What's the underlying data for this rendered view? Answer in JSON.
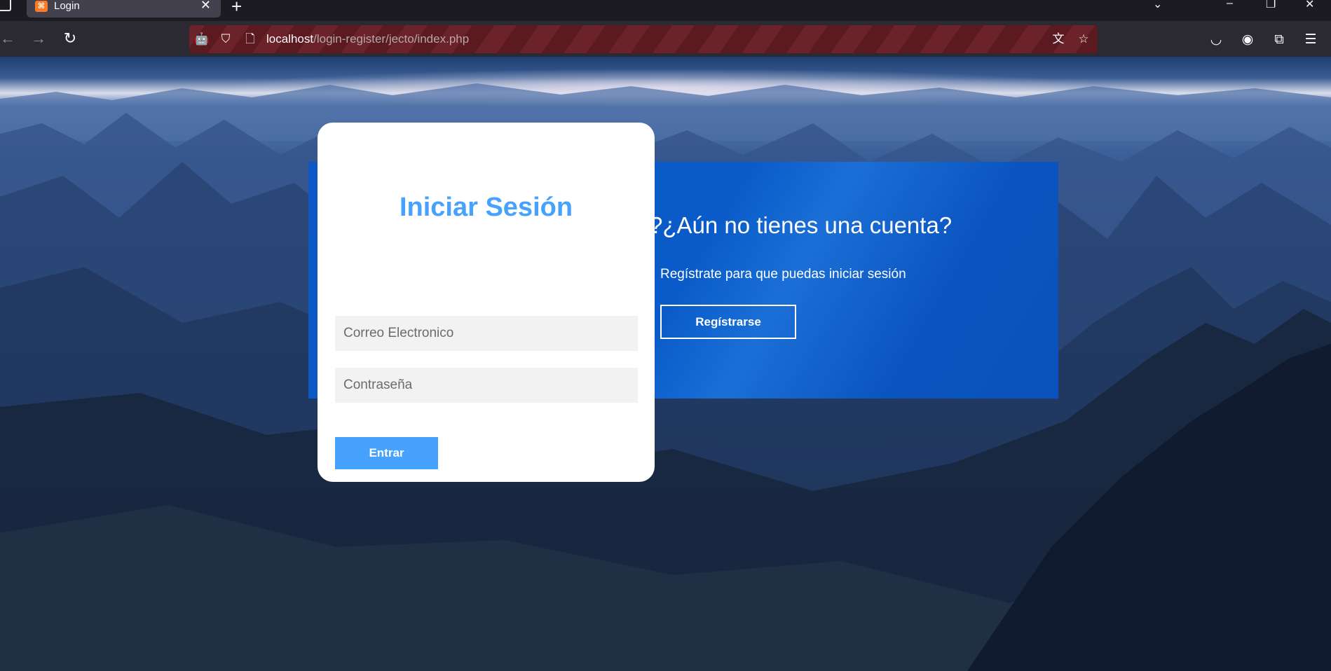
{
  "browser": {
    "tab": {
      "title": "Login",
      "favicon": "xampp-icon"
    },
    "url": {
      "host": "localhost",
      "path": "/login-register/jecto/index.php"
    },
    "colors": {
      "chrome_bg": "#1c1b22",
      "toolbar_bg": "#2b2a33",
      "tab_bg": "#42414d"
    }
  },
  "login": {
    "title": "Iniciar Sesión",
    "email_placeholder": "Correo Electronico",
    "password_placeholder": "Contraseña",
    "submit_label": "Entrar"
  },
  "register": {
    "title": "?¿Aún no tienes una cuenta?",
    "text": "Regístrate para que puedas iniciar sesión",
    "button_label": "Regístrarse"
  },
  "colors": {
    "accent": "#46a2fd",
    "panel_blue": "#0a5bc9",
    "input_bg": "#f2f2f2",
    "card_bg": "#ffffff"
  }
}
